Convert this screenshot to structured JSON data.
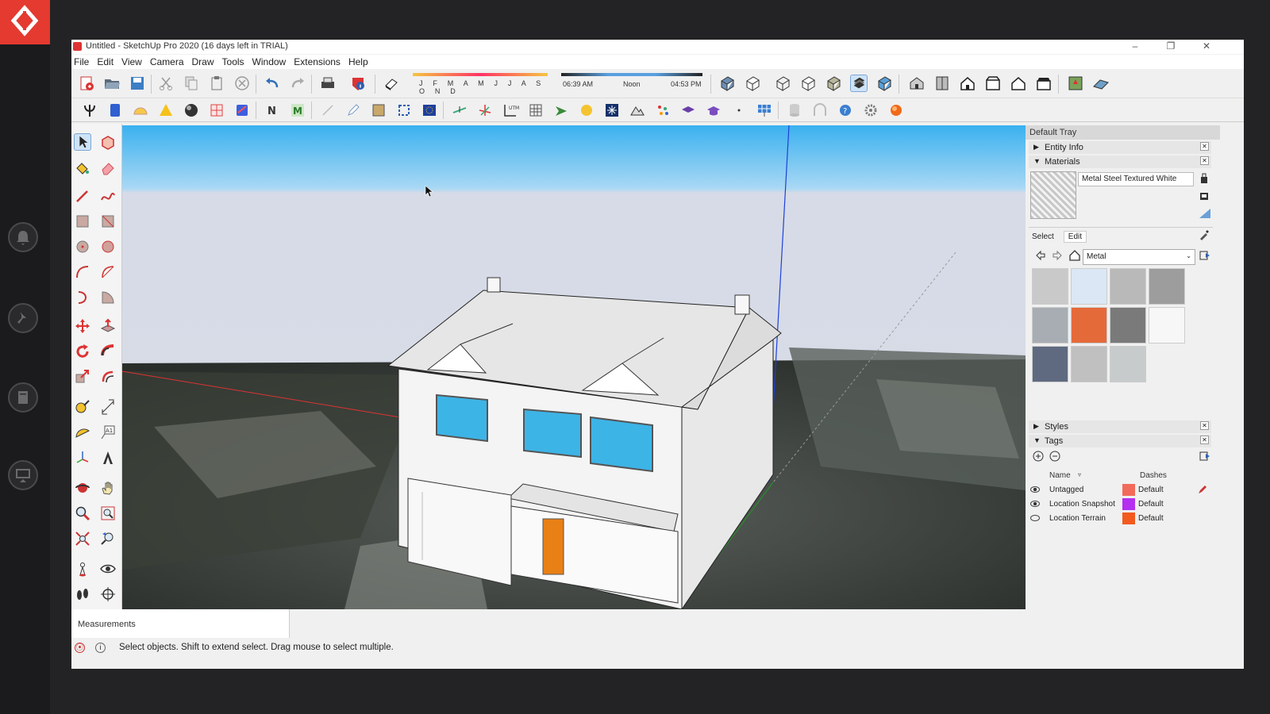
{
  "window": {
    "title": "Untitled - SketchUp Pro 2020 (16 days left in TRIAL)",
    "controls": [
      "–",
      "❐",
      "✕"
    ]
  },
  "menu": [
    "File",
    "Edit",
    "View",
    "Camera",
    "Draw",
    "Tools",
    "Window",
    "Extensions",
    "Help"
  ],
  "shadow": {
    "months": "J F M A M J J A S O N D",
    "time_start": "06:39 AM",
    "time_mid": "Noon",
    "time_end": "04:53 PM"
  },
  "measurements_label": "Measurements",
  "status_text": "Select objects. Shift to extend select. Drag mouse to select multiple.",
  "tray": {
    "title": "Default Tray",
    "sections": {
      "entity_info": "Entity Info",
      "materials": "Materials",
      "styles": "Styles",
      "tags": "Tags"
    },
    "material_name": "Metal Steel Textured White",
    "tab_select": "Select",
    "tab_edit": "Edit",
    "library": "Metal",
    "swatches": [
      "#c9c9c9",
      "#dbe7f5",
      "#b9b9b9",
      "#9d9d9d",
      "#a7adb3",
      "#e56a3a",
      "#7a7a7a",
      "#f7f7f7",
      "#5f6a80",
      "#c0c0c0",
      "#c7cbcc"
    ],
    "tags_columns": {
      "name": "Name",
      "dashes": "Dashes"
    },
    "tags": [
      {
        "name": "Untagged",
        "color": "#f26a5a",
        "dashes": "Default"
      },
      {
        "name": "Location Snapshot",
        "color": "#b42ff0",
        "dashes": "Default"
      },
      {
        "name": "Location Terrain",
        "color": "#f25a1e",
        "dashes": "Default"
      }
    ]
  },
  "model_colors": {
    "sky_top": "#3ab1f0",
    "sky_bottom": "#d6dbe7",
    "wall": "#f4f4f4",
    "window": "#3db4e6",
    "door": "#e98016"
  }
}
